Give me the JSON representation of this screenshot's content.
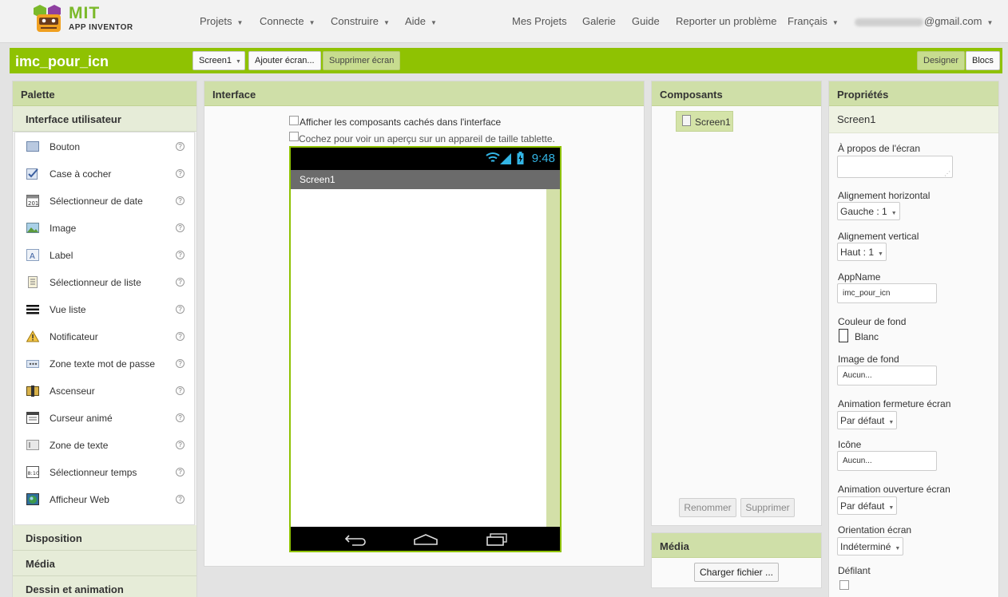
{
  "nav": {
    "logo_title": "MIT",
    "logo_subtitle": "APP INVENTOR",
    "menus_left": [
      "Projets",
      "Connecte",
      "Construire",
      "Aide"
    ],
    "links_right": [
      "Mes Projets",
      "Galerie",
      "Guide",
      "Reporter un problème"
    ],
    "language": "Français",
    "account_suffix": "@gmail.com"
  },
  "project": {
    "name": "imc_pour_icn",
    "screen_select": "Screen1",
    "add_screen": "Ajouter écran...",
    "remove_screen": "Supprimer écran",
    "designer": "Designer",
    "blocks": "Blocs"
  },
  "palette": {
    "title": "Palette",
    "category_open": "Interface utilisateur",
    "items": [
      {
        "label": "Bouton",
        "icon": "button-icon"
      },
      {
        "label": "Case à cocher",
        "icon": "checkbox-icon"
      },
      {
        "label": "Sélectionneur de date",
        "icon": "calendar-icon"
      },
      {
        "label": "Image",
        "icon": "image-icon"
      },
      {
        "label": "Label",
        "icon": "label-icon"
      },
      {
        "label": "Sélectionneur de liste",
        "icon": "listpicker-icon"
      },
      {
        "label": "Vue liste",
        "icon": "listview-icon"
      },
      {
        "label": "Notificateur",
        "icon": "warning-icon"
      },
      {
        "label": "Zone texte mot de passe",
        "icon": "password-icon"
      },
      {
        "label": "Ascenseur",
        "icon": "slider-icon"
      },
      {
        "label": "Curseur animé",
        "icon": "spinner-icon"
      },
      {
        "label": "Zone de texte",
        "icon": "textbox-icon"
      },
      {
        "label": "Sélectionneur temps",
        "icon": "timepicker-icon"
      },
      {
        "label": "Afficheur Web",
        "icon": "web-icon"
      }
    ],
    "help_glyph": "?",
    "categories_closed": [
      "Disposition",
      "Média",
      "Dessin et animation"
    ]
  },
  "interface": {
    "title": "Interface",
    "show_hidden": "Afficher les composants cachés dans l'interface",
    "tablet_preview": "Cochez pour voir un aperçu sur un appareil de taille tablette.",
    "phone_time": "9:48",
    "screen_title": "Screen1"
  },
  "components": {
    "title": "Composants",
    "tree_root": "Screen1",
    "rename": "Renommer",
    "delete": "Supprimer"
  },
  "media": {
    "title": "Média",
    "upload": "Charger fichier ..."
  },
  "properties": {
    "title": "Propriétés",
    "subject": "Screen1",
    "about_label": "À propos de l'écran",
    "halign_label": "Alignement horizontal",
    "halign_value": "Gauche : 1",
    "valign_label": "Alignement vertical",
    "valign_value": "Haut : 1",
    "appname_label": "AppName",
    "appname_value": "imc_pour_icn",
    "bgcolor_label": "Couleur de fond",
    "bgcolor_value": "Blanc",
    "bgimage_label": "Image de fond",
    "bgimage_value": "Aucun...",
    "close_anim_label": "Animation fermeture écran",
    "close_anim_value": "Par défaut",
    "icon_label": "Icône",
    "icon_value": "Aucun...",
    "open_anim_label": "Animation ouverture écran",
    "open_anim_value": "Par défaut",
    "orientation_label": "Orientation écran",
    "orientation_value": "Indéterminé",
    "scrollable_label": "Défilant"
  },
  "colors": {
    "brand_green": "#8fc202",
    "panel_header": "#cfdfa8",
    "phone_time": "#33b5e5"
  }
}
